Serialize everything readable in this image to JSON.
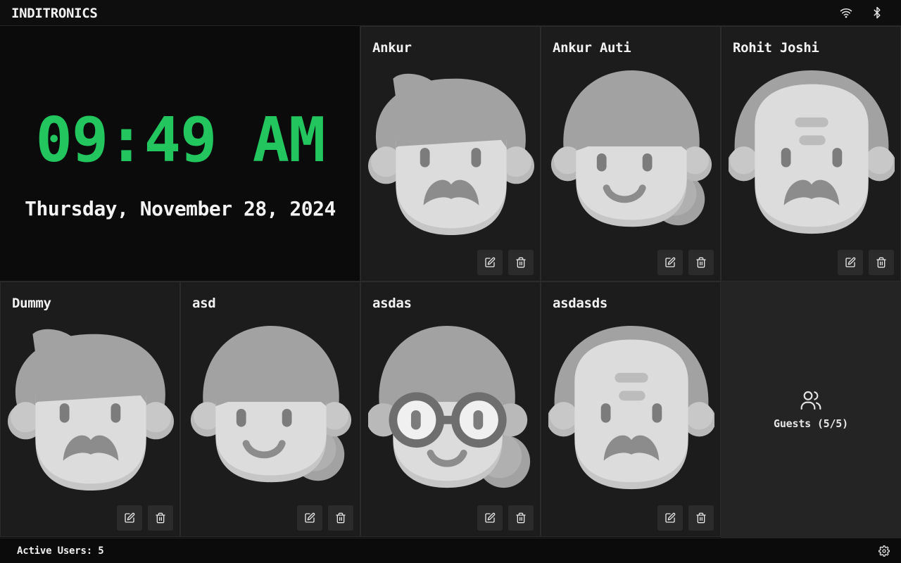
{
  "header": {
    "brand": "INDITRONICS",
    "icons": [
      "wifi-icon",
      "bluetooth-icon"
    ]
  },
  "clock": {
    "time": "09:49 AM",
    "date": "Thursday, November 28, 2024",
    "time_color": "#22c55e"
  },
  "users": [
    {
      "name": "Ankur",
      "avatar": "man-mustache-avatar"
    },
    {
      "name": "Ankur Auti",
      "avatar": "woman-bun-avatar"
    },
    {
      "name": "Rohit Joshi",
      "avatar": "elderly-man-avatar"
    },
    {
      "name": "Dummy",
      "avatar": "man-mustache-avatar"
    },
    {
      "name": "asd",
      "avatar": "woman-bun-avatar"
    },
    {
      "name": "asdas",
      "avatar": "woman-glasses-avatar"
    },
    {
      "name": "asdasds",
      "avatar": "elderly-man-avatar"
    }
  ],
  "card_actions": {
    "edit_icon": "edit-icon",
    "delete_icon": "trash-icon"
  },
  "guests": {
    "label": "Guests (5/5)",
    "icon": "users-icon"
  },
  "footer": {
    "active_users": "Active Users: 5",
    "settings_icon": "gear-icon"
  }
}
